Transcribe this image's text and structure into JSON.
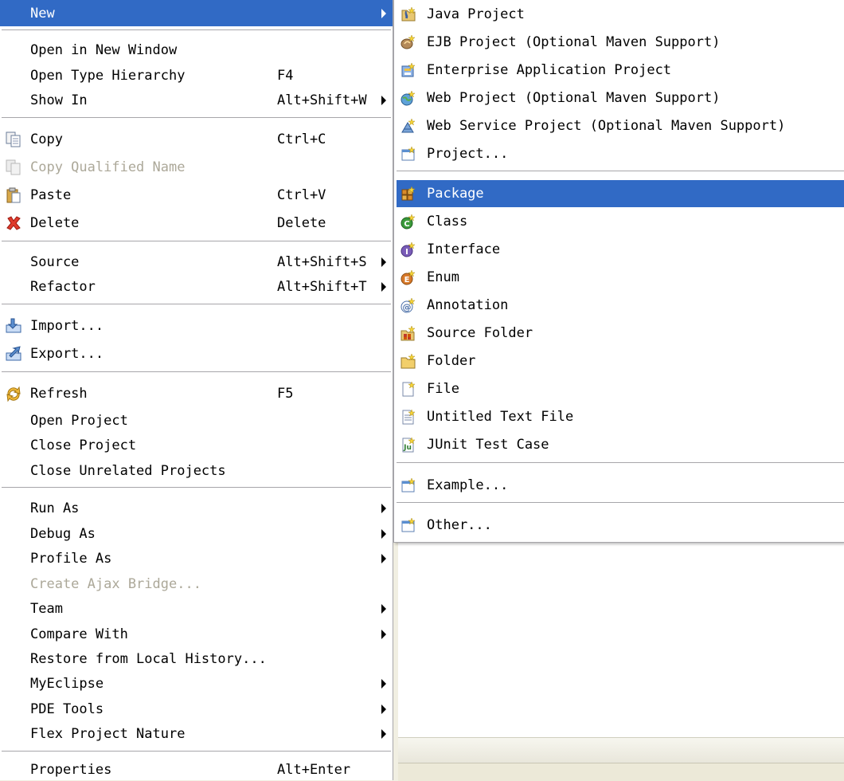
{
  "main_menu": {
    "new": "New",
    "open_new_window": "Open in New Window",
    "open_type_hierarchy": "Open Type Hierarchy",
    "open_type_hierarchy_key": "F4",
    "show_in": "Show In",
    "show_in_key": "Alt+Shift+W",
    "copy": "Copy",
    "copy_key": "Ctrl+C",
    "copy_qualified_name": "Copy Qualified Name",
    "paste": "Paste",
    "paste_key": "Ctrl+V",
    "delete": "Delete",
    "delete_key": "Delete",
    "source": "Source",
    "source_key": "Alt+Shift+S",
    "refactor": "Refactor",
    "refactor_key": "Alt+Shift+T",
    "import": "Import...",
    "export": "Export...",
    "refresh": "Refresh",
    "refresh_key": "F5",
    "open_project": "Open Project",
    "close_project": "Close Project",
    "close_unrelated": "Close Unrelated Projects",
    "run_as": "Run As",
    "debug_as": "Debug As",
    "profile_as": "Profile As",
    "create_ajax_bridge": "Create Ajax Bridge...",
    "team": "Team",
    "compare_with": "Compare With",
    "restore_history": "Restore from Local History...",
    "myeclipse": "MyEclipse",
    "pde_tools": "PDE Tools",
    "flex_nature": "Flex Project Nature",
    "properties": "Properties",
    "properties_key": "Alt+Enter"
  },
  "sub_menu": {
    "java_project": "Java Project",
    "ejb_project": "EJB Project (Optional Maven Support)",
    "enterprise_app_project": "Enterprise Application Project",
    "web_project": "Web Project (Optional Maven Support)",
    "web_service_project": "Web Service Project (Optional Maven Support)",
    "project": "Project...",
    "package": "Package",
    "class": "Class",
    "interface": "Interface",
    "enum": "Enum",
    "annotation": "Annotation",
    "source_folder": "Source Folder",
    "folder": "Folder",
    "file": "File",
    "untitled_text_file": "Untitled Text File",
    "junit_test_case": "JUnit Test Case",
    "example": "Example...",
    "other": "Other..."
  },
  "colors": {
    "highlight": "#316ac5",
    "disabled_text": "#aca899",
    "menu_bg": "#ffffff"
  }
}
